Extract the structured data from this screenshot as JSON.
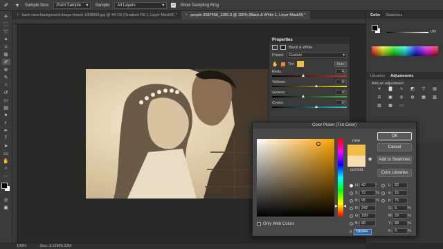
{
  "options_bar": {
    "sample_size_label": "Sample Size:",
    "sample_size_value": "Point Sample",
    "sample_label": "Sample:",
    "sample_value": "All Layers",
    "show_ring_label": "Show Sampling Ring"
  },
  "tabs": [
    {
      "label": "back-view-background-image-beach-1008000.jpg @ 44.1% (Gradient Fill 1, Layer Mask/8) *",
      "active": false
    },
    {
      "label": "people-2587456_1280-3 @ 100% (Black & White 1, Layer Mask/8) *",
      "active": true
    }
  ],
  "properties": {
    "title": "Properties",
    "layer_label": "Black & White",
    "preset_label": "Preset:",
    "preset_value": "Custom",
    "tint_label": "Tint",
    "auto_label": "Auto",
    "sliders": [
      {
        "label": "Reds:",
        "value": "40",
        "pos": 0.42,
        "gradient": "linear-gradient(to right, #000, #e02a2a)"
      },
      {
        "label": "Yellows:",
        "value": "60",
        "pos": 0.6,
        "gradient": "linear-gradient(to right, #000, #f0e030)"
      },
      {
        "label": "Greens:",
        "value": "40",
        "pos": 0.42,
        "gradient": "linear-gradient(to right, #000, #2fbf3a)"
      },
      {
        "label": "Cyans:",
        "value": "60",
        "pos": 0.6,
        "gradient": "linear-gradient(to right, #000, #2fc9d9)"
      }
    ]
  },
  "right_panel": {
    "tabs_top": [
      "Color",
      "Swatches"
    ],
    "opacity_value": "100",
    "tabs_mid": [
      "Libraries",
      "Adjustments"
    ],
    "add_adjustment": "Add an adjustment"
  },
  "picker": {
    "title": "Color Picker (Tint Color)",
    "new_label": "new",
    "current_label": "current",
    "ok_label": "OK",
    "cancel_label": "Cancel",
    "add_swatches_label": "Add to Swatches",
    "color_libraries_label": "Color Libraries",
    "only_web_label": "Only Web Colors",
    "new_color": "#f2bd44",
    "current_color": "#f7ddb0",
    "hsb": [
      {
        "k": "H:",
        "v": "42",
        "u": "°"
      },
      {
        "k": "S:",
        "v": "72",
        "u": "%"
      },
      {
        "k": "B:",
        "v": "95",
        "u": "%"
      }
    ],
    "rgb": [
      {
        "k": "R:",
        "v": "242"
      },
      {
        "k": "G:",
        "v": "189"
      },
      {
        "k": "B:",
        "v": "68"
      }
    ],
    "lab": [
      {
        "k": "L:",
        "v": "82"
      },
      {
        "k": "a:",
        "v": "15"
      },
      {
        "k": "b:",
        "v": "75"
      }
    ],
    "cmyk": [
      {
        "k": "C:",
        "v": "5",
        "u": "%"
      },
      {
        "k": "M:",
        "v": "29",
        "u": "%"
      },
      {
        "k": "Y:",
        "v": "88",
        "u": "%"
      },
      {
        "k": "K:",
        "v": "0",
        "u": "%"
      }
    ],
    "hex_label": "#",
    "hex_value": "f2bd44"
  },
  "status": {
    "zoom": "100%",
    "doc": "Doc: 3.12M/3.12M"
  }
}
